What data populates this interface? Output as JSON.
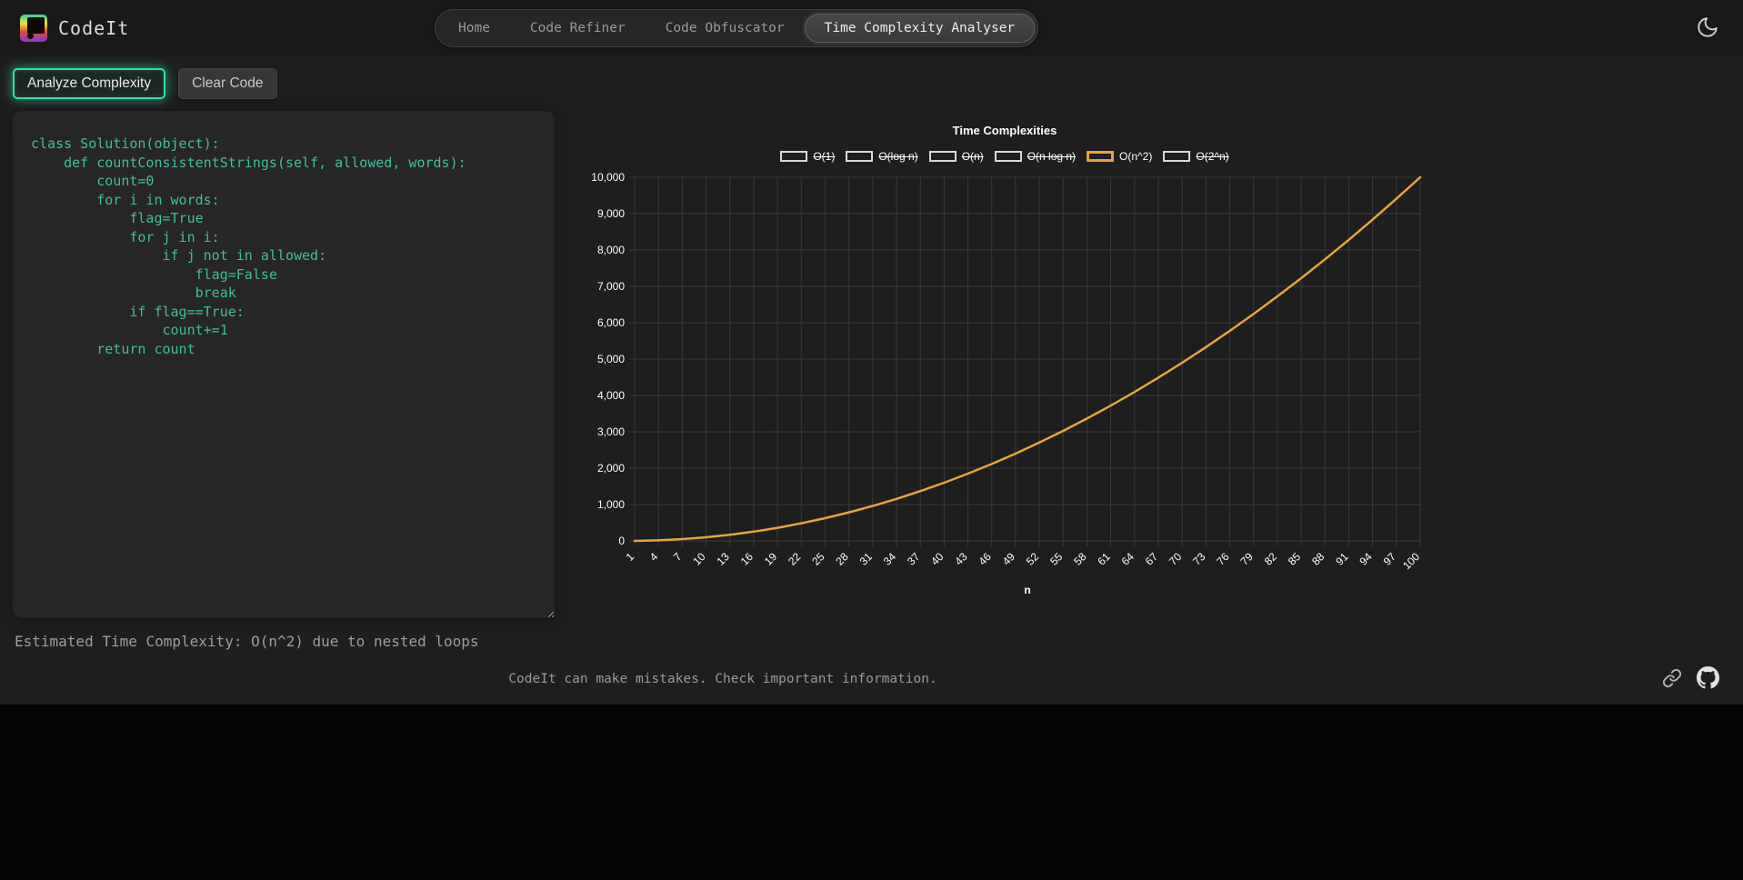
{
  "header": {
    "brand": "CodeIt",
    "nav_items": [
      {
        "label": "Home",
        "active": false
      },
      {
        "label": "Code Refiner",
        "active": false
      },
      {
        "label": "Code Obfuscator",
        "active": false
      },
      {
        "label": "Time Complexity Analyser",
        "active": true
      }
    ]
  },
  "toolbar": {
    "analyze_label": "Analyze Complexity",
    "clear_label": "Clear Code"
  },
  "editor": {
    "code": "class Solution(object):\n    def countConsistentStrings(self, allowed, words):\n        count=0\n        for i in words:\n            flag=True\n            for j in i:\n                if j not in allowed:\n                    flag=False\n                    break\n            if flag==True:\n                count+=1\n        return count",
    "result": "Estimated Time Complexity: O(n^2) due to nested loops"
  },
  "chart_data": {
    "type": "line",
    "title": "Time Complexities",
    "xlabel": "n",
    "ylabel": "",
    "x": [
      1,
      4,
      7,
      10,
      13,
      16,
      19,
      22,
      25,
      28,
      31,
      34,
      37,
      40,
      43,
      46,
      49,
      52,
      55,
      58,
      61,
      64,
      67,
      70,
      73,
      76,
      79,
      82,
      85,
      88,
      91,
      94,
      97,
      100
    ],
    "ylim": [
      0,
      10000
    ],
    "y_ticks": [
      0,
      1000,
      2000,
      3000,
      4000,
      5000,
      6000,
      7000,
      8000,
      9000,
      10000
    ],
    "grid": true,
    "legend_position": "top",
    "series": [
      {
        "name": "O(1)",
        "hidden": true,
        "values": []
      },
      {
        "name": "O(log n)",
        "hidden": true,
        "values": []
      },
      {
        "name": "O(n)",
        "hidden": true,
        "values": []
      },
      {
        "name": "O(n log n)",
        "hidden": true,
        "values": []
      },
      {
        "name": "O(n^2)",
        "hidden": false,
        "color": "#e8a33d",
        "values": [
          1,
          16,
          49,
          100,
          169,
          256,
          361,
          484,
          625,
          784,
          961,
          1156,
          1369,
          1600,
          1849,
          2116,
          2401,
          2704,
          3025,
          3364,
          3721,
          4096,
          4489,
          4900,
          5329,
          5776,
          6241,
          6724,
          7225,
          7744,
          8281,
          8836,
          9409,
          10000
        ]
      },
      {
        "name": "O(2^n)",
        "hidden": true,
        "values": []
      }
    ],
    "colors": {
      "grid": "#3a3a3a",
      "axis_text": "#ffffff",
      "hidden_legend_box": "#d9d9d9"
    }
  },
  "footer": {
    "disclaimer": "CodeIt can make mistakes. Check important information."
  },
  "theme": {
    "accent_teal": "#35dcae",
    "code_color": "#3fbf9f",
    "line_orange": "#e8a33d",
    "background": "#1e1e1e"
  }
}
